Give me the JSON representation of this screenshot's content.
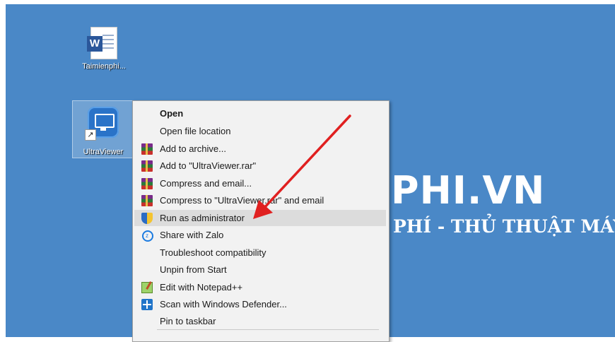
{
  "watermark": {
    "big": "PHI.VN",
    "small": "PHÍ - THỦ THUẬT MÁY"
  },
  "desktop_icons": [
    {
      "label": "Taimienphi...",
      "icon": "word-document-icon"
    },
    {
      "label": "UltraViewer",
      "icon": "ultraviewer-icon"
    }
  ],
  "context_menu": {
    "items": [
      {
        "label": "Open",
        "icon": null,
        "bold": true
      },
      {
        "label": "Open file location",
        "icon": null
      },
      {
        "label": "Add to archive...",
        "icon": "winrar-icon"
      },
      {
        "label": "Add to \"UltraViewer.rar\"",
        "icon": "winrar-icon"
      },
      {
        "label": "Compress and email...",
        "icon": "winrar-icon"
      },
      {
        "label": "Compress to \"UltraViewer.rar\" and email",
        "icon": "winrar-icon"
      },
      {
        "label": "Run as administrator",
        "icon": "uac-shield-icon",
        "highlighted": true
      },
      {
        "label": "Share with Zalo",
        "icon": "zalo-icon"
      },
      {
        "label": "Troubleshoot compatibility",
        "icon": null
      },
      {
        "label": "Unpin from Start",
        "icon": null
      },
      {
        "label": "Edit with Notepad++",
        "icon": "notepad-plus-plus-icon"
      },
      {
        "label": "Scan with Windows Defender...",
        "icon": "windows-defender-icon"
      },
      {
        "label": "Pin to taskbar",
        "icon": null
      }
    ]
  },
  "colors": {
    "desktop_bg": "#4a88c7",
    "menu_bg": "#f2f2f2",
    "highlight": "#dcdcdc",
    "arrow": "#e02020"
  }
}
